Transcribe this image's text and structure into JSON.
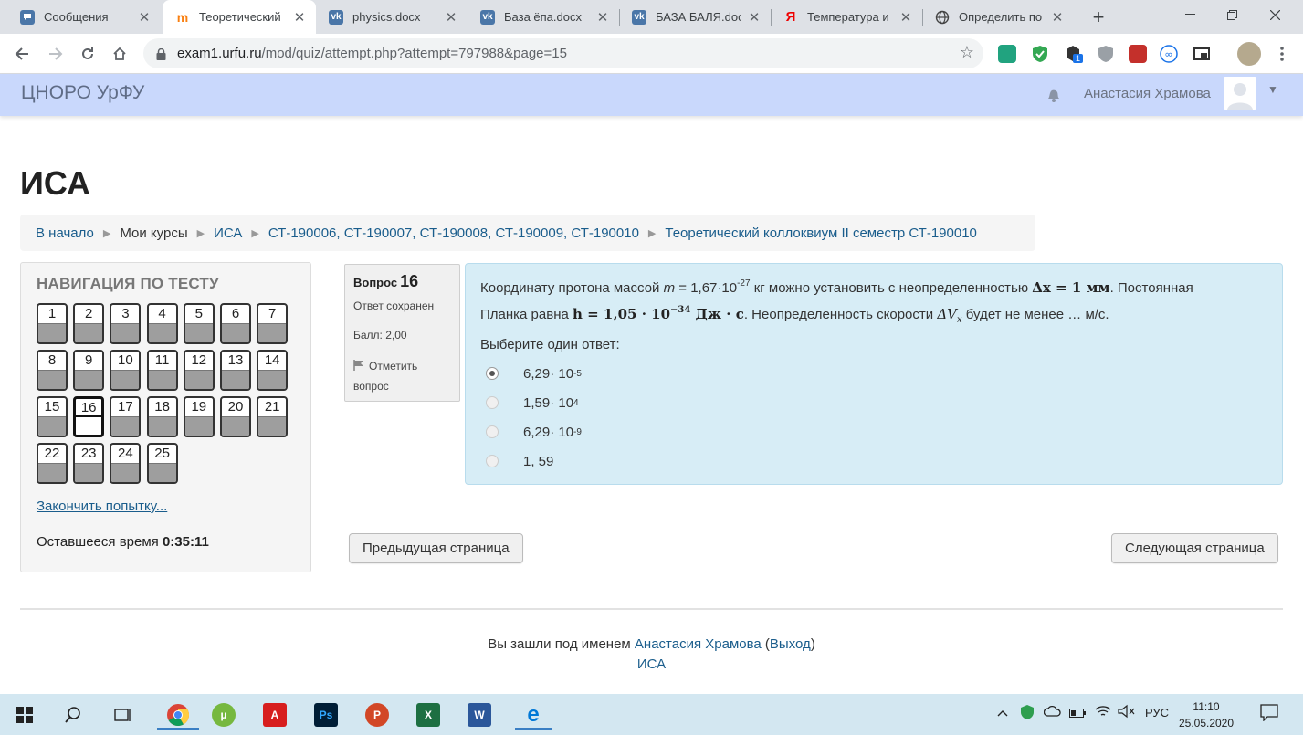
{
  "browser": {
    "tabs": [
      {
        "label": "Сообщения",
        "favicon": "vk-messages-icon",
        "color": "#4a76a8"
      },
      {
        "label": "Теоретический",
        "favicon": "moodle-icon",
        "color": "#f98012",
        "active": true
      },
      {
        "label": "physics.docx",
        "favicon": "vk-icon",
        "color": "#4a76a8"
      },
      {
        "label": "База ёпа.docx",
        "favicon": "vk-icon",
        "color": "#4a76a8"
      },
      {
        "label": "БАЗА БАЛЯ.doc",
        "favicon": "vk-icon",
        "color": "#4a76a8"
      },
      {
        "label": "Температура и",
        "favicon": "yandex-icon",
        "color": "#ff0000"
      },
      {
        "label": "Определить по",
        "favicon": "globe-icon",
        "color": "#555555"
      }
    ],
    "new_tab_label": "+",
    "url_host": "exam1.urfu.ru",
    "url_path": "/mod/quiz/attempt.php?attempt=797988&page=15",
    "extension_badge": "1"
  },
  "site": {
    "brand": "ЦНОРО УрФУ",
    "user_name": "Анастасия Храмова"
  },
  "page": {
    "title": "ИСА",
    "breadcrumb": {
      "home": "В начало",
      "my_courses": "Мои курсы",
      "course": "ИСА",
      "group": "СТ-190006, СТ-190007, СТ-190008, СТ-190009, СТ-190010",
      "quiz": "Теоретический коллоквиум II семестр СТ-190010"
    }
  },
  "quiz_nav": {
    "title": "НАВИГАЦИЯ ПО ТЕСТУ",
    "current": "16",
    "buttons": [
      "1",
      "2",
      "3",
      "4",
      "5",
      "6",
      "7",
      "8",
      "9",
      "10",
      "11",
      "12",
      "13",
      "14",
      "15",
      "16",
      "17",
      "18",
      "19",
      "20",
      "21",
      "22",
      "23",
      "24",
      "25"
    ],
    "finish_link": "Закончить попытку...",
    "time_label": "Оставшееся время",
    "time_value": "0:35:11"
  },
  "question": {
    "label": "Вопрос",
    "number": "16",
    "state": "Ответ сохранен",
    "grade": "Балл: 2,00",
    "flag_label": "Отметить вопрос",
    "text_part1": "Координату протона массой",
    "mass_symbol": "m",
    "mass_value": "= 1,67·10",
    "mass_exp": "-27",
    "text_part2": "кг можно установить с неопределенностью",
    "dx_expr": "Δx = 1 мм",
    "text_part3": ". Постоянная",
    "text_part4": "Планка равна",
    "hbar_expr": "ħ = 1,05 · 10",
    "hbar_exp": "−34",
    "hbar_units": "Дж · с",
    "text_part5": ". Неопределенность скорости",
    "dv_expr": "ΔV",
    "dv_sub": "x",
    "text_part6": "будет не менее … м/с.",
    "prompt": "Выберите один ответ:",
    "options": [
      {
        "mantissa": "6,29· 10",
        "exp": "-5",
        "selected": true
      },
      {
        "mantissa": "1,59· 10",
        "exp": "4",
        "selected": false
      },
      {
        "mantissa": "6,29· 10",
        "exp": "-9",
        "selected": false
      },
      {
        "mantissa": "1, 59",
        "exp": "",
        "selected": false
      }
    ]
  },
  "buttons": {
    "prev": "Предыдущая страница",
    "next": "Следующая страница"
  },
  "footer": {
    "logged_in_as": "Вы зашли под именем",
    "user": "Анастасия Храмова",
    "logout": "Выход",
    "home": "ИСА"
  },
  "taskbar": {
    "lang": "РУС",
    "time": "11:10",
    "date": "25.05.2020"
  },
  "colors": {
    "navbar_bg": "#c9d8fc",
    "question_bg": "#d7edf6",
    "link": "#1a5d8c",
    "taskbar_bg": "#d3e7f1"
  }
}
